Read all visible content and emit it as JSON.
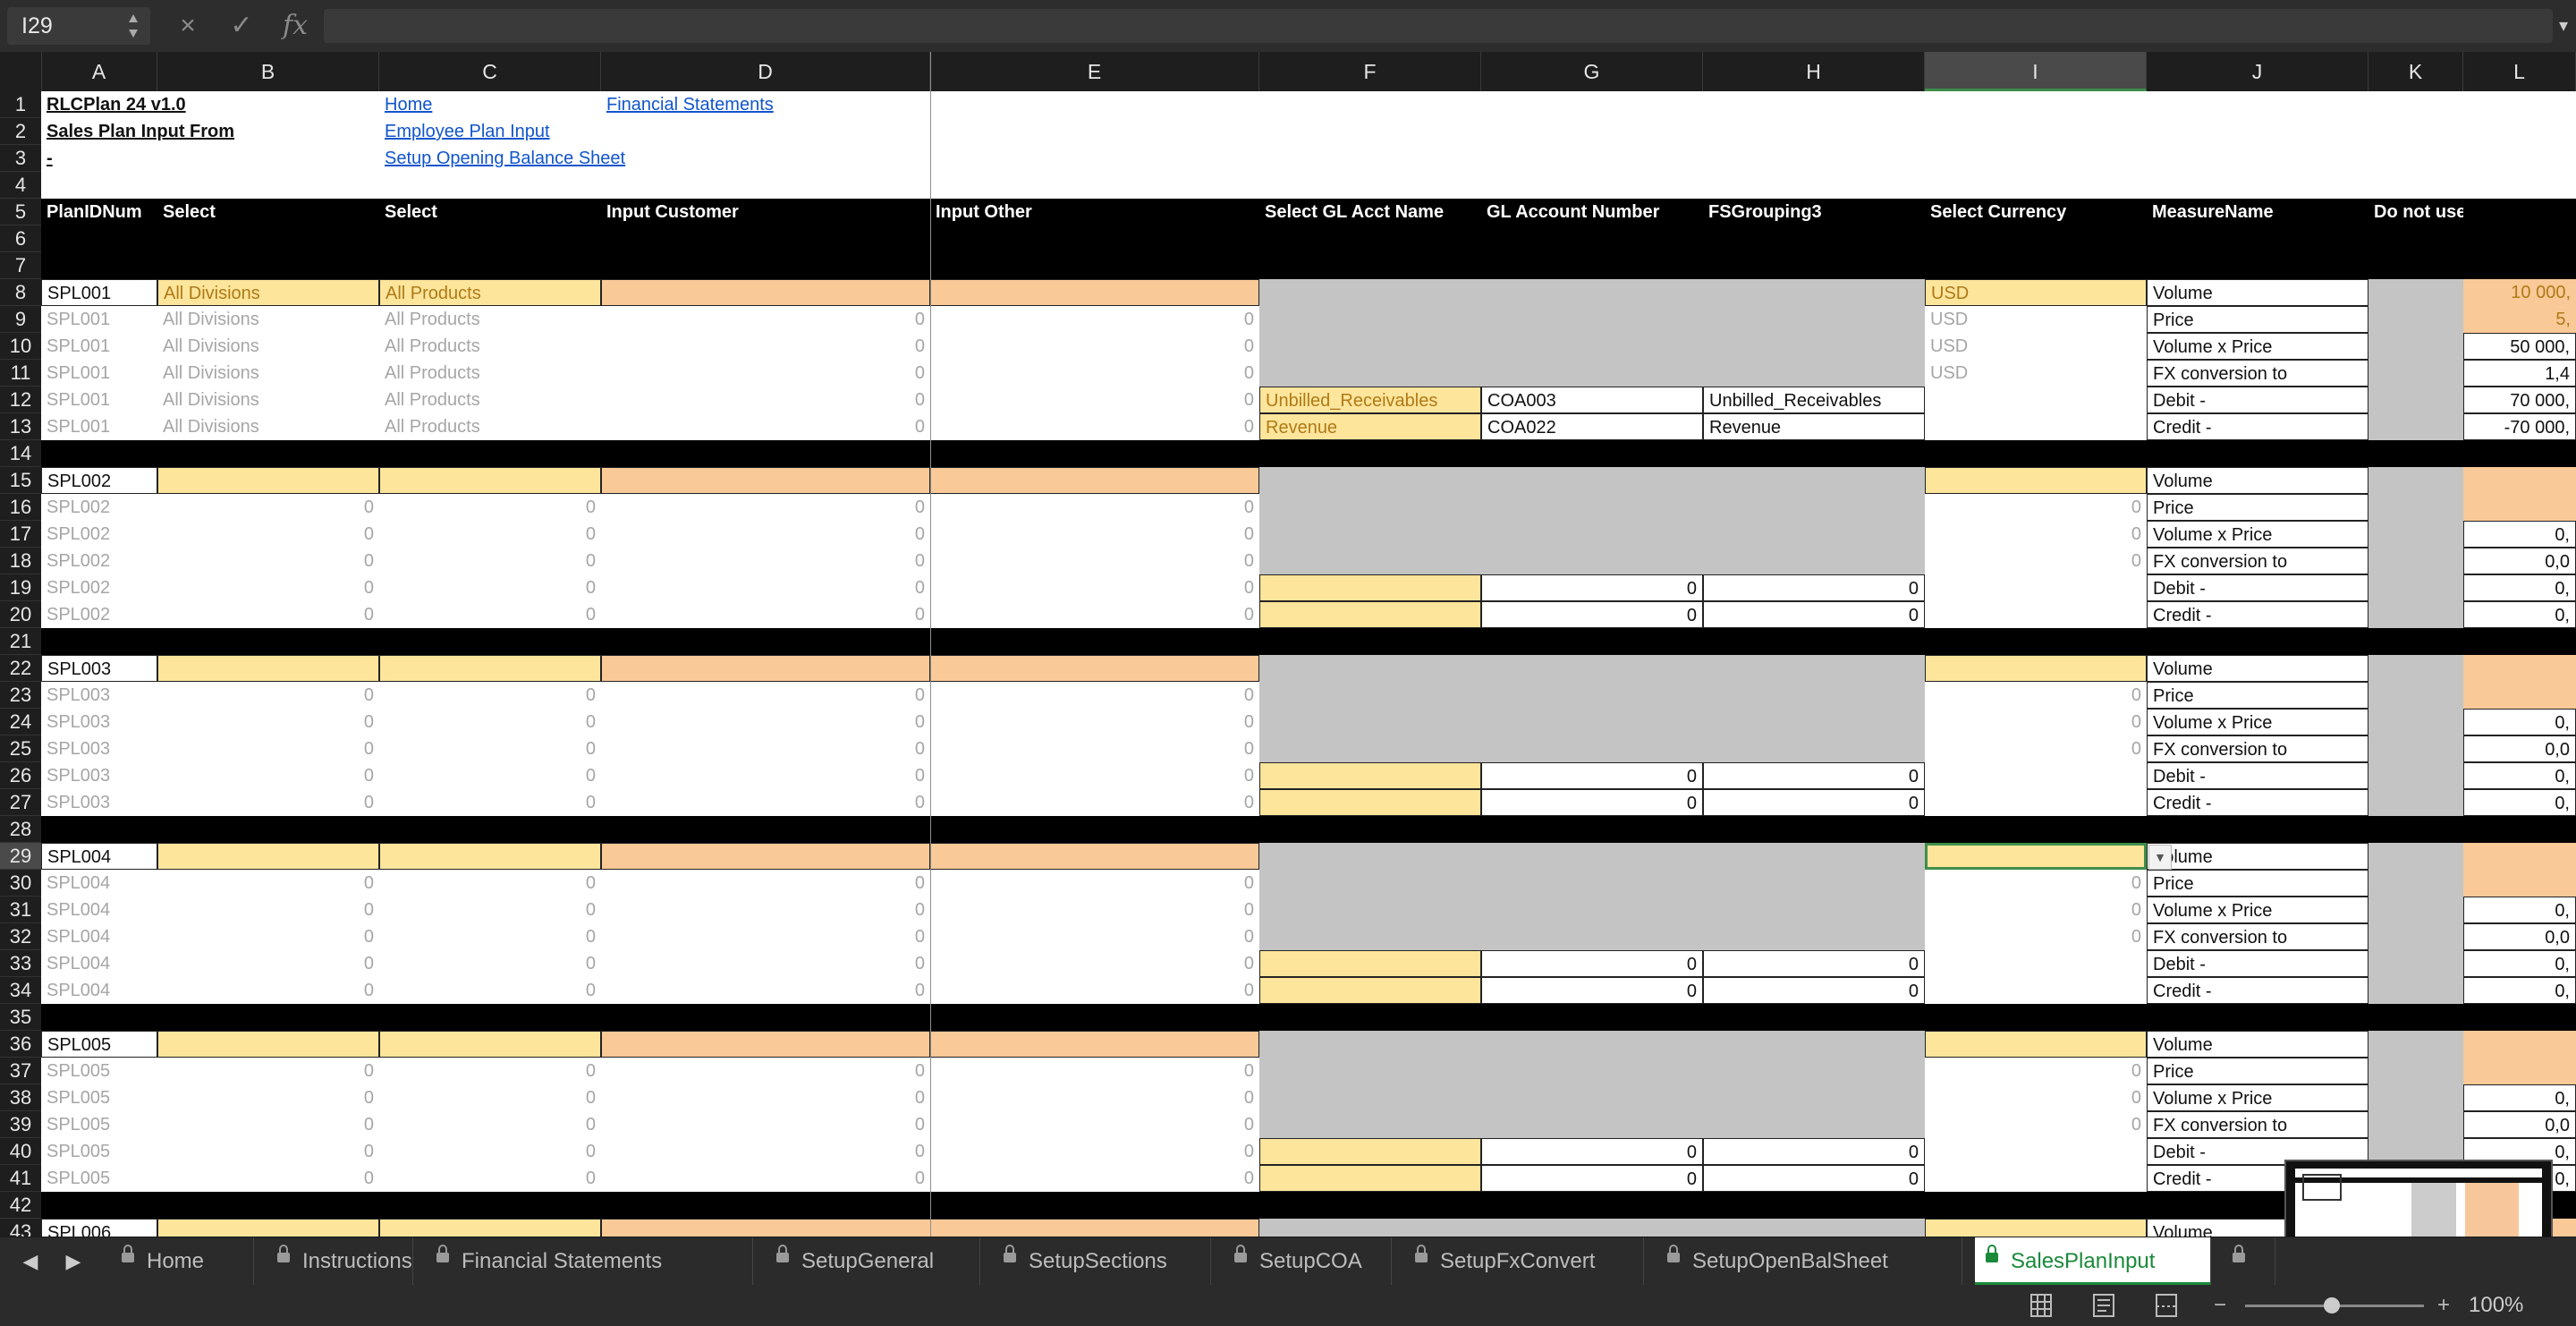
{
  "formula_bar": {
    "cell_ref": "I29",
    "cancel_icon": "×",
    "enter_icon": "✓",
    "fx_label": "fx",
    "formula": ""
  },
  "columns": [
    {
      "id": "A",
      "label": "A"
    },
    {
      "id": "B",
      "label": "B"
    },
    {
      "id": "C",
      "label": "C"
    },
    {
      "id": "D",
      "label": "D"
    },
    {
      "id": "E",
      "label": "E"
    },
    {
      "id": "F",
      "label": "F"
    },
    {
      "id": "G",
      "label": "G"
    },
    {
      "id": "H",
      "label": "H"
    },
    {
      "id": "I",
      "label": "I"
    },
    {
      "id": "J",
      "label": "J"
    },
    {
      "id": "K",
      "label": "K"
    },
    {
      "id": "L",
      "label": "L"
    }
  ],
  "selected_column": "I",
  "selected_row": 29,
  "title_block": {
    "title": "RLCPlan 24 v1.0",
    "subtitle": "Sales Plan Input From",
    "dash": "-",
    "links": [
      "Home",
      "Employee Plan Input",
      "Setup Opening Balance Sheet",
      "Financial Statements"
    ]
  },
  "header_row": [
    "PlanIDNum",
    "Select",
    "Select",
    "Input Customer",
    "Input Other",
    "Select GL Acct Name",
    "GL Account Number",
    "FSGrouping3",
    "Select Currency",
    "MeasureName",
    "Do not use"
  ],
  "measures": [
    "Volume",
    "Price",
    "Volume x Price",
    "FX conversion to",
    "Debit -",
    "Credit -"
  ],
  "blocks": [
    {
      "id": "SPL001",
      "start": 8,
      "division": "All Divisions",
      "product": "All Products",
      "currency": "USD",
      "gl_names": [
        "Unbilled_Receivables",
        "Revenue"
      ],
      "gl_numbers": [
        "COA003",
        "COA022"
      ],
      "fs_groups": [
        "Unbilled_Receivables",
        "Revenue"
      ],
      "l_values": [
        "10 000,",
        "5,",
        "50 000,",
        "1,4",
        "70 000,",
        "-70 000,"
      ]
    },
    {
      "id": "SPL002",
      "start": 15,
      "division": "",
      "product": "",
      "currency": "",
      "gl_names": [
        "",
        ""
      ],
      "gl_numbers": [
        "0",
        "0"
      ],
      "fs_groups": [
        "0",
        "0"
      ],
      "l_values": [
        "",
        "",
        "0,",
        "0,0",
        "0,",
        "0,"
      ]
    },
    {
      "id": "SPL003",
      "start": 22,
      "division": "",
      "product": "",
      "currency": "",
      "gl_names": [
        "",
        ""
      ],
      "gl_numbers": [
        "0",
        "0"
      ],
      "fs_groups": [
        "0",
        "0"
      ],
      "l_values": [
        "",
        "",
        "0,",
        "0,0",
        "0,",
        "0,"
      ]
    },
    {
      "id": "SPL004",
      "start": 29,
      "division": "",
      "product": "",
      "currency": "",
      "gl_names": [
        "",
        ""
      ],
      "gl_numbers": [
        "0",
        "0"
      ],
      "fs_groups": [
        "0",
        "0"
      ],
      "l_values": [
        "",
        "",
        "0,",
        "0,0",
        "0,",
        "0,"
      ]
    },
    {
      "id": "SPL005",
      "start": 36,
      "division": "",
      "product": "",
      "currency": "",
      "gl_names": [
        "",
        ""
      ],
      "gl_numbers": [
        "0",
        "0"
      ],
      "fs_groups": [
        "0",
        "0"
      ],
      "l_values": [
        "",
        "",
        "0,",
        "0,0",
        "0,",
        "0,"
      ]
    }
  ],
  "partial_block": {
    "id": "SPL006",
    "start": 43
  },
  "zero": "0",
  "tabs": [
    "Home",
    "Instructions",
    "Financial Statements",
    "SetupGeneral",
    "SetupSections",
    "SetupCOA",
    "SetupFxConvert",
    "SetupOpenBalSheet",
    "SalesPlanInput"
  ],
  "active_tab": "SalesPlanInput",
  "status": {
    "zoom": "100%",
    "zoom_minus": "−",
    "zoom_plus": "+"
  }
}
